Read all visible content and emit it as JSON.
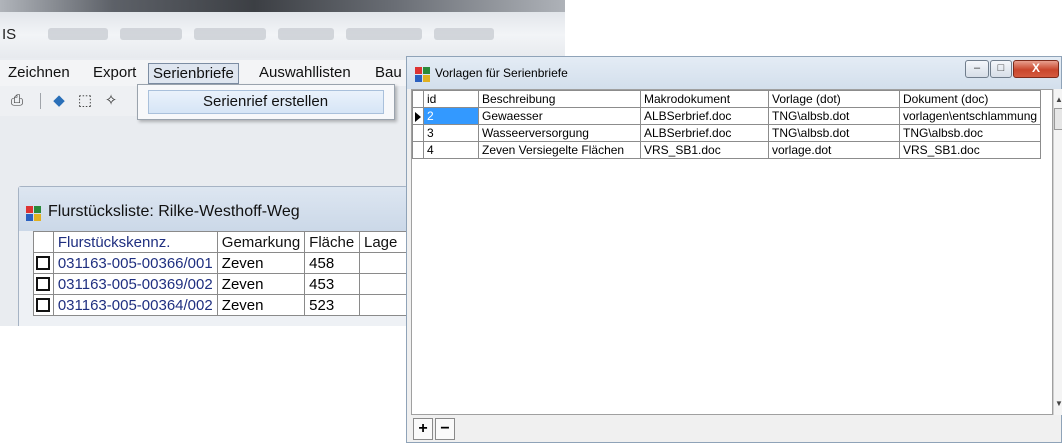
{
  "app": {
    "title": "IS",
    "menu": [
      "Zeichnen",
      "Export",
      "Serienbriefe",
      "Auswahllisten",
      "Bau"
    ],
    "active_menu": "Serienbriefe",
    "dropdown_item": "Serienrief erstellen"
  },
  "flur": {
    "title": "Flurstücksliste: Rilke-Westhoff-Weg",
    "columns": [
      "Flurstückskennz.",
      "Gemarkung",
      "Fläche",
      "Lage"
    ],
    "rows": [
      {
        "kennz": "031163-005-00366/001",
        "gemarkung": "Zeven",
        "flaeche": "458",
        "lage": ""
      },
      {
        "kennz": "031163-005-00369/002",
        "gemarkung": "Zeven",
        "flaeche": "453",
        "lage": ""
      },
      {
        "kennz": "031163-005-00364/002",
        "gemarkung": "Zeven",
        "flaeche": "523",
        "lage": ""
      }
    ]
  },
  "dialog": {
    "title": "Vorlagen für Serienbriefe",
    "buttons": {
      "minimize": "–",
      "maximize": "□",
      "close": "X"
    },
    "columns": [
      "id",
      "Beschreibung",
      "Makrodokument",
      "Vorlage (dot)",
      "Dokument (doc)"
    ],
    "rows": [
      {
        "id": "2",
        "beschreibung": "Gewaesser",
        "makro": "ALBSerbrief.doc",
        "vorlage": "TNG\\albsb.dot",
        "dokument": "vorlagen\\entschlammung"
      },
      {
        "id": "3",
        "beschreibung": "Wasseerversorgung",
        "makro": "ALBSerbrief.doc",
        "vorlage": "TNG\\albsb.dot",
        "dokument": "TNG\\albsb.doc"
      },
      {
        "id": "4",
        "beschreibung": "Zeven Versiegelte Flächen",
        "makro": "VRS_SB1.doc",
        "vorlage": "vorlage.dot",
        "dokument": "VRS_SB1.doc"
      }
    ],
    "nav": {
      "add": "+",
      "remove": "−"
    }
  },
  "colors": {
    "selection": "#3399ff",
    "link_text": "#1f2f80"
  }
}
